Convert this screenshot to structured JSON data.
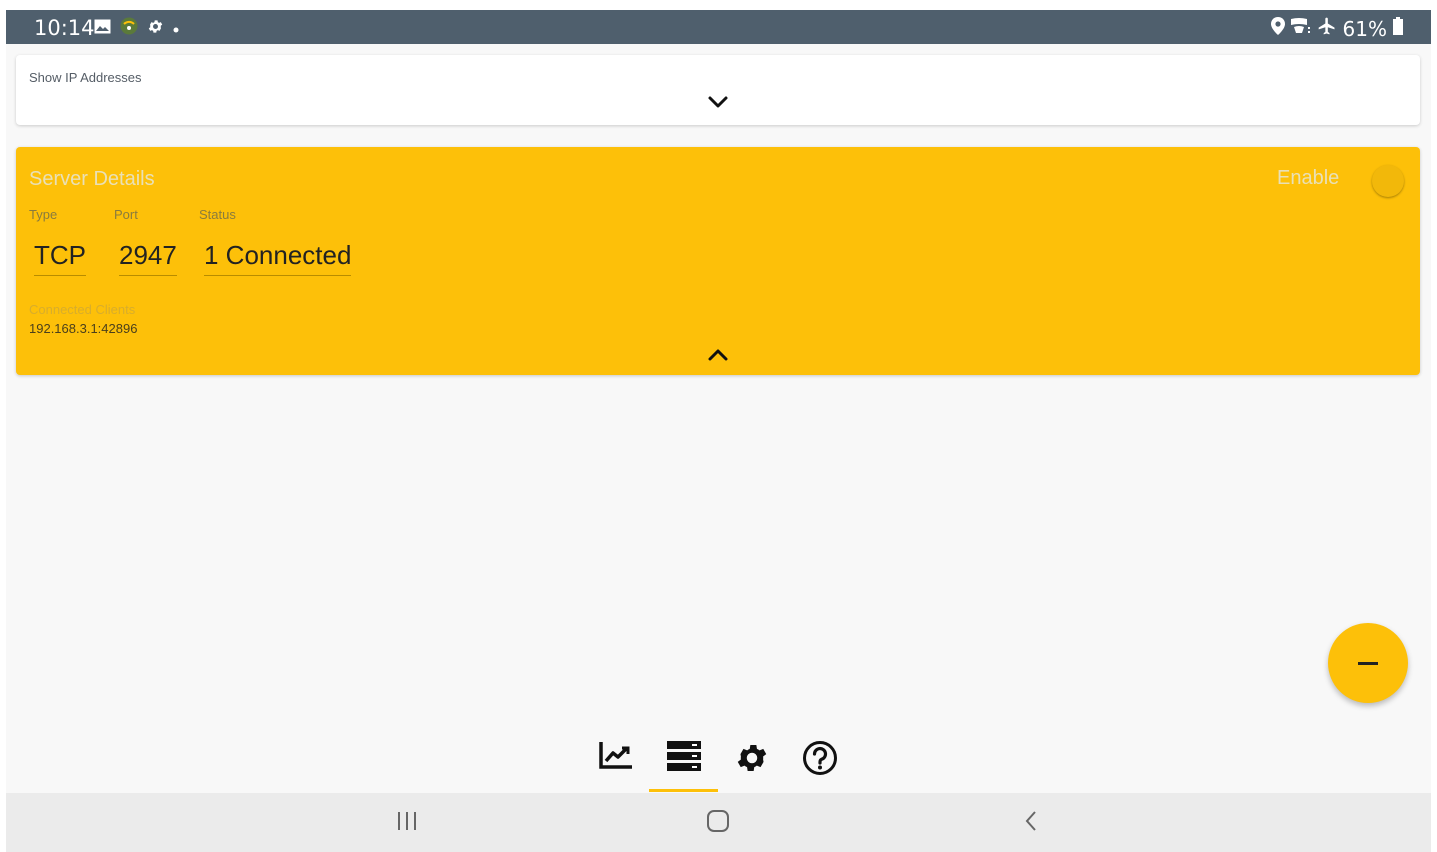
{
  "status_bar": {
    "time": "10:14",
    "left_icons": [
      "gallery-icon",
      "vpn-icon",
      "settings-icon",
      "dot-icon"
    ],
    "right_icons": [
      "location-icon",
      "wifi-calling-icon",
      "airplane-icon"
    ],
    "battery": "61%"
  },
  "ip_panel": {
    "label": "Show IP Addresses",
    "expand_icon": "chevron-down-icon"
  },
  "server": {
    "title": "Server Details",
    "enable_label": "Enable",
    "enabled": false,
    "columns": [
      {
        "label": "Type",
        "value": "TCP"
      },
      {
        "label": "Port",
        "value": "2947"
      },
      {
        "label": "Status",
        "value": "1 Connected"
      }
    ],
    "clients_label": "Connected Clients",
    "clients": [
      "192.168.3.1:42896"
    ],
    "collapse_icon": "chevron-up-icon"
  },
  "fab": {
    "icon": "minus-icon"
  },
  "tabs": [
    {
      "name": "chart-tab",
      "icon": "chart-icon",
      "active": false
    },
    {
      "name": "server-tab",
      "icon": "server-icon",
      "active": true
    },
    {
      "name": "settings-tab",
      "icon": "gear-icon",
      "active": false
    },
    {
      "name": "help-tab",
      "icon": "help-icon",
      "active": false
    }
  ],
  "colors": {
    "accent": "#fdc009",
    "status_bar": "#4f5f6d",
    "background": "#f8f8f8"
  },
  "nav": [
    "recents-icon",
    "home-icon",
    "back-icon"
  ]
}
